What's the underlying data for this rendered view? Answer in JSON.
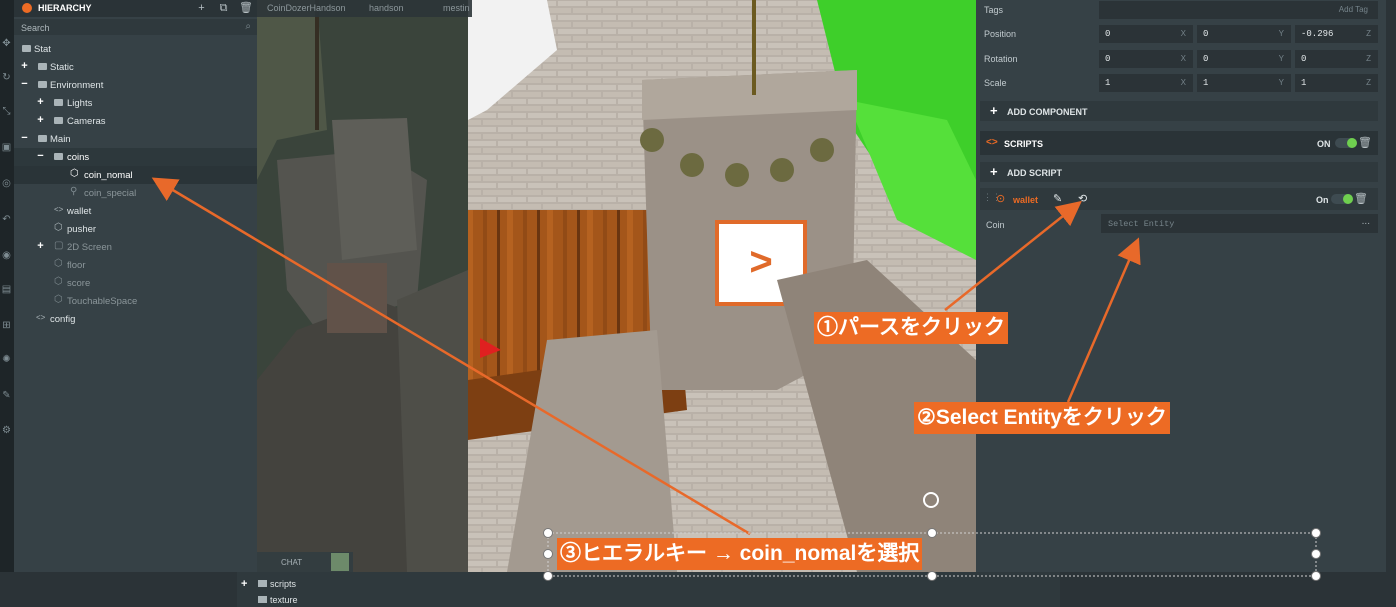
{
  "hierarchy": {
    "title": "HIERARCHY",
    "search_placeholder": "Search",
    "items": [
      {
        "label": "Stat"
      },
      {
        "label": "Static"
      },
      {
        "label": "Environment"
      },
      {
        "label": "Lights"
      },
      {
        "label": "Cameras"
      },
      {
        "label": "Main"
      },
      {
        "label": "coins"
      },
      {
        "label": "coin_nomal"
      },
      {
        "label": "coin_special"
      },
      {
        "label": "wallet"
      },
      {
        "label": "pusher"
      },
      {
        "label": "2D Screen"
      },
      {
        "label": "floor"
      },
      {
        "label": "score"
      },
      {
        "label": "TouchableSpace"
      },
      {
        "label": "config"
      }
    ]
  },
  "viewport": {
    "tabs": [
      "CoinDozerHandson",
      "handson",
      "mestin"
    ],
    "chat_label": "CHAT"
  },
  "inspector": {
    "tags": {
      "label": "Tags",
      "placeholder": "Add Tag"
    },
    "position": {
      "label": "Position",
      "x": "0",
      "y": "0",
      "z": "-0.296"
    },
    "rotation": {
      "label": "Rotation",
      "x": "0",
      "y": "0",
      "z": "0"
    },
    "scale": {
      "label": "Scale",
      "x": "1",
      "y": "1",
      "z": "1"
    },
    "axes": [
      "X",
      "Y",
      "Z"
    ],
    "add_component": "ADD COMPONENT",
    "scripts": {
      "title": "SCRIPTS",
      "state": "ON"
    },
    "add_script": "ADD SCRIPT",
    "wallet": {
      "name": "wallet",
      "state": "On"
    },
    "coin": {
      "label": "Coin",
      "placeholder": "Select Entity",
      "more": "..."
    }
  },
  "assets": {
    "items": [
      "scripts",
      "texture"
    ]
  },
  "callouts": {
    "step1": "①パースをクリック",
    "step2": "②Select Entityをクリック",
    "step3": "③ヒエラルキー → coin_nomalを選択"
  },
  "colors": {
    "accent_orange": "#ed6b24",
    "toggle_green": "#6fcf4f",
    "panel_bg": "#364146",
    "arrow": "#e8692a"
  }
}
